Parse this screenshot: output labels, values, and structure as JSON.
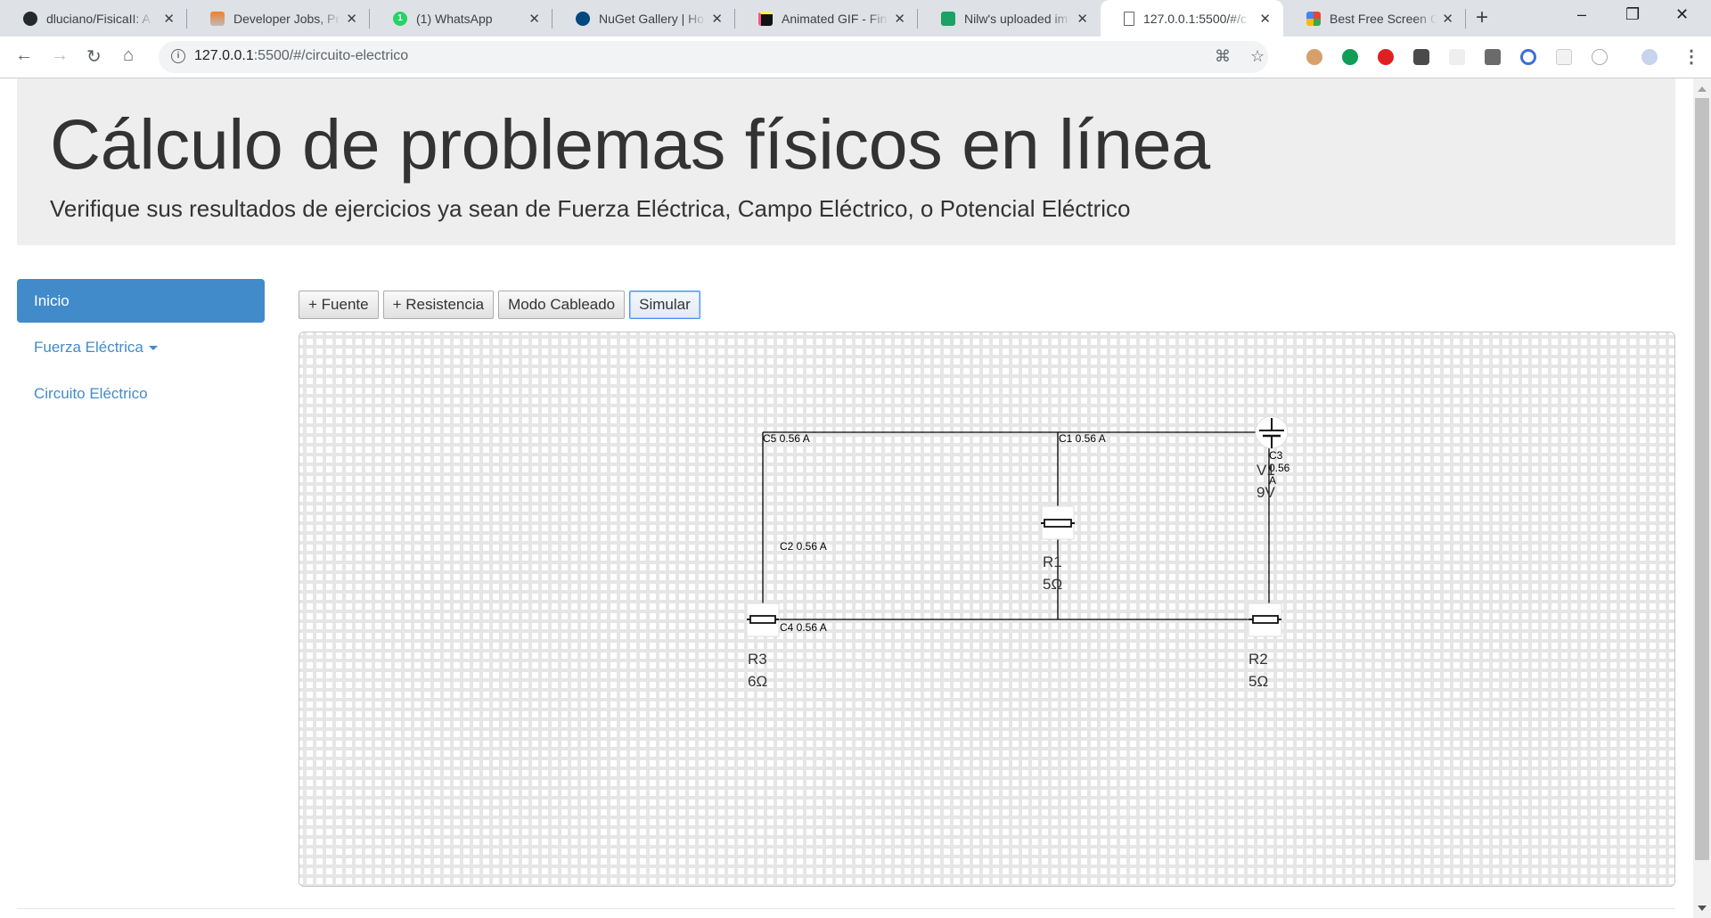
{
  "browser": {
    "tabs": [
      {
        "title": "dluciano/FisicaII: A",
        "icon": "github-icon",
        "active": false
      },
      {
        "title": "Developer Jobs, Pr",
        "icon": "stackoverflow-icon",
        "active": false
      },
      {
        "title": "(1) WhatsApp",
        "icon": "whatsapp-icon",
        "active": false,
        "badge": "1"
      },
      {
        "title": "NuGet Gallery | Ho",
        "icon": "nuget-icon",
        "active": false
      },
      {
        "title": "Animated GIF - Fin",
        "icon": "gif-icon",
        "active": false
      },
      {
        "title": "Nilw's uploaded im",
        "icon": "image-upload-icon",
        "active": false
      },
      {
        "title": "127.0.0.1:5500/#/c",
        "icon": "page-icon",
        "active": true
      },
      {
        "title": "Best Free Screen C",
        "icon": "screen-capture-icon",
        "active": false
      }
    ],
    "new_tab": "+",
    "url_host": "127.0.0.1",
    "url_rest": ":5500/#/circuito-electrico",
    "window_controls": {
      "minimize": "–",
      "maximize": "❐",
      "close": "✕"
    }
  },
  "header": {
    "title": "Cálculo de problemas físicos en línea",
    "subtitle": "Verifique sus resultados de ejercicios ya sean de Fuerza Eléctrica, Campo Eléctrico, o Potencial Eléctrico"
  },
  "sidebar": {
    "items": [
      {
        "label": "Inicio",
        "active": true
      },
      {
        "label": "Fuerza Eléctrica",
        "dropdown": true
      },
      {
        "label": "Circuito Eléctrico"
      }
    ]
  },
  "toolbar": {
    "add_source": "+ Fuente",
    "add_resistor": "+ Resistencia",
    "wiring_mode": "Modo Cableado",
    "simulate": "Simular"
  },
  "circuit": {
    "source": {
      "name": "V1",
      "value": "9V"
    },
    "resistors": [
      {
        "name": "R1",
        "value": "5Ω"
      },
      {
        "name": "R2",
        "value": "5Ω"
      },
      {
        "name": "R3",
        "value": "6Ω"
      }
    ],
    "currents": [
      {
        "label": "C1 0.56 A"
      },
      {
        "label": "C2 0.56 A"
      },
      {
        "label": "C3 0.56 A",
        "line1": "C3",
        "line2": "0.56",
        "line3": "A"
      },
      {
        "label": "C4 0.56 A"
      },
      {
        "label": "C5 0.56 A"
      }
    ]
  }
}
